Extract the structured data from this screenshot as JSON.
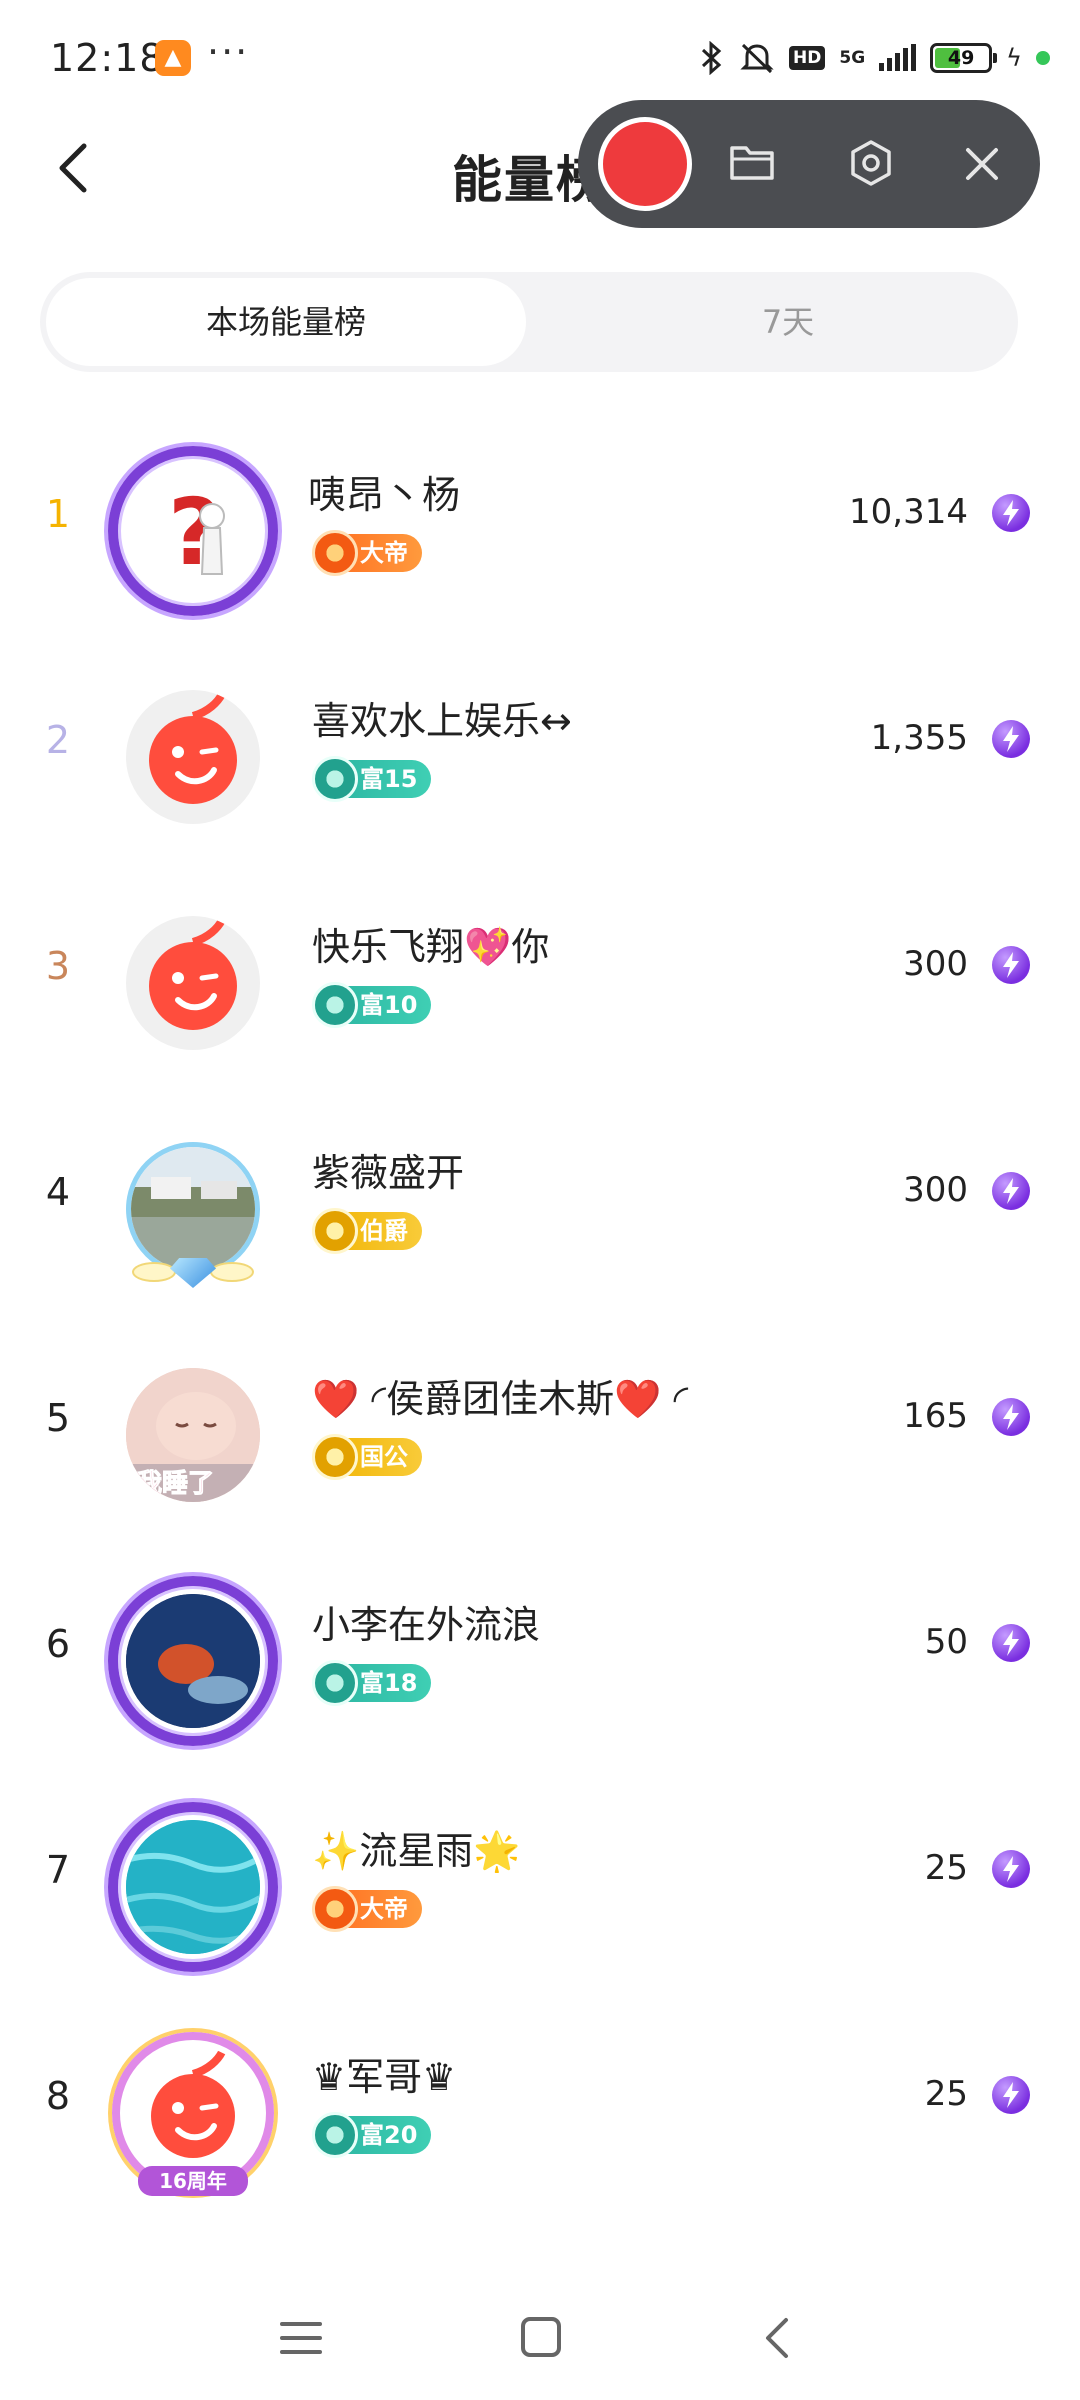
{
  "status_bar": {
    "time": "12:18",
    "more": "···",
    "hd": "HD",
    "network": "5G",
    "battery": "49",
    "battery_level": 0.49
  },
  "header": {
    "title": "能量榜"
  },
  "tabs": [
    {
      "label": "本场能量榜",
      "active": true
    },
    {
      "label": "7天",
      "active": false
    }
  ],
  "ranking": [
    {
      "rank": "1",
      "name": "咦昂丶杨",
      "badge": "大帝",
      "badge_style": "orange",
      "score": "10,314",
      "rank_color": "#f5b301"
    },
    {
      "rank": "2",
      "name": "喜欢水上娱乐↔",
      "badge": "富15",
      "badge_style": "teal",
      "score": "1,355",
      "rank_color": "#b7b2e6"
    },
    {
      "rank": "3",
      "name": "快乐飞翔💖你",
      "badge": "富10",
      "badge_style": "teal",
      "score": "300",
      "rank_color": "#c9865b"
    },
    {
      "rank": "4",
      "name": "紫薇盛开",
      "badge": "伯爵",
      "badge_style": "gold",
      "score": "300",
      "rank_color": "#222222"
    },
    {
      "rank": "5",
      "name": "❤️ ◜侯爵团佳木斯❤️ ◜",
      "badge": "国公",
      "badge_style": "gold",
      "score": "165",
      "rank_color": "#222222"
    },
    {
      "rank": "6",
      "name": "小李在外流浪",
      "badge": "富18",
      "badge_style": "teal",
      "score": "50",
      "rank_color": "#222222"
    },
    {
      "rank": "7",
      "name": "✨流星雨🌟",
      "badge": "大帝",
      "badge_style": "orange",
      "score": "25",
      "rank_color": "#222222"
    },
    {
      "rank": "8",
      "name": "♛军哥♛",
      "badge": "富20",
      "badge_style": "teal",
      "score": "25",
      "rank_color": "#222222"
    }
  ],
  "avatar_texts": {
    "rank5": "我睡了",
    "rank8": "16周年"
  },
  "colors": {
    "accent_record": "#ee3a3d",
    "energy": "#7a2ee0"
  }
}
